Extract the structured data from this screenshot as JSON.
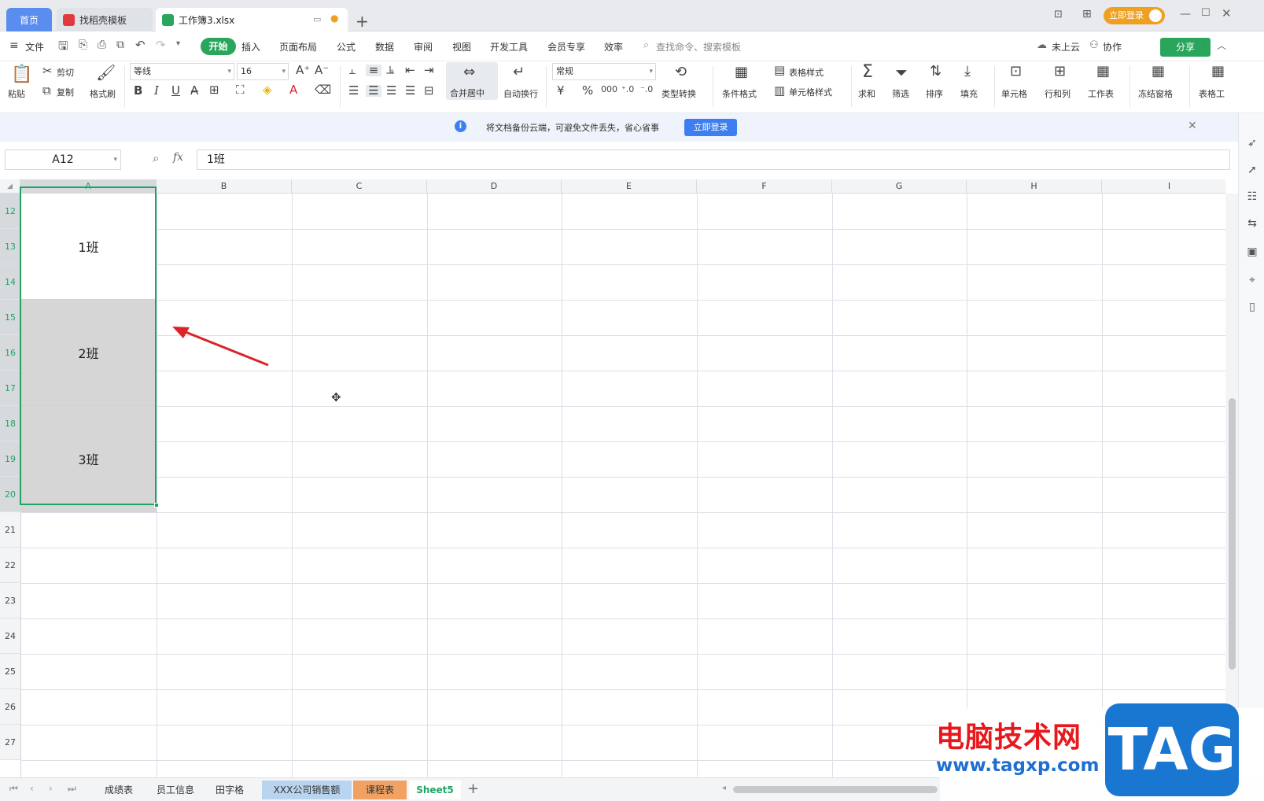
{
  "tabs": {
    "home": "首页",
    "templates": "找稻壳模板",
    "workbook": "工作簿3.xlsx"
  },
  "titlebar": {
    "login": "立即登录"
  },
  "menu": {
    "file": "文件",
    "items": [
      "开始",
      "插入",
      "页面布局",
      "公式",
      "数据",
      "审阅",
      "视图",
      "开发工具",
      "会员专享",
      "效率"
    ],
    "search": "查找命令、搜索模板",
    "cloud": "未上云",
    "collab": "协作",
    "share": "分享"
  },
  "ribbon": {
    "paste": "粘贴",
    "cut": "剪切",
    "copy": "复制",
    "format_painter": "格式刷",
    "font_name": "等线",
    "font_size": "16",
    "merge_center": "合并居中",
    "wrap_text": "自动换行",
    "number_format": "常规",
    "type_convert": "类型转换",
    "conditional_format": "条件格式",
    "table_style": "表格样式",
    "cell_style": "单元格样式",
    "sum": "求和",
    "filter": "筛选",
    "sort": "排序",
    "fill": "填充",
    "cell": "单元格",
    "rowcol": "行和列",
    "worksheet": "工作表",
    "freeze": "冻结窗格",
    "table_tools": "表格工"
  },
  "notice": {
    "text": "将文档备份云端，可避免文件丢失，省心省事",
    "button": "立即登录"
  },
  "formula": {
    "namebox": "A12",
    "fx": "fx",
    "content": "1班"
  },
  "grid": {
    "columns": [
      "A",
      "B",
      "C",
      "D",
      "E",
      "F",
      "G",
      "H",
      "I"
    ],
    "rows": [
      "12",
      "13",
      "14",
      "15",
      "16",
      "17",
      "18",
      "19",
      "20",
      "21",
      "22",
      "23",
      "24",
      "25",
      "26",
      "27"
    ],
    "merged": [
      "1班",
      "2班",
      "3班"
    ]
  },
  "sheets": [
    "成绩表",
    "员工信息",
    "田字格",
    "XXX公司销售额",
    "课程表",
    "Sheet5"
  ],
  "watermark": {
    "cn": "电脑技术网",
    "tag": "TAG",
    "url": "www.tagxp.com"
  },
  "colors": {
    "accent": "#2aa65c",
    "selection": "#21a366",
    "arrow": "#d9252a",
    "blue": "#3d7ff0"
  }
}
